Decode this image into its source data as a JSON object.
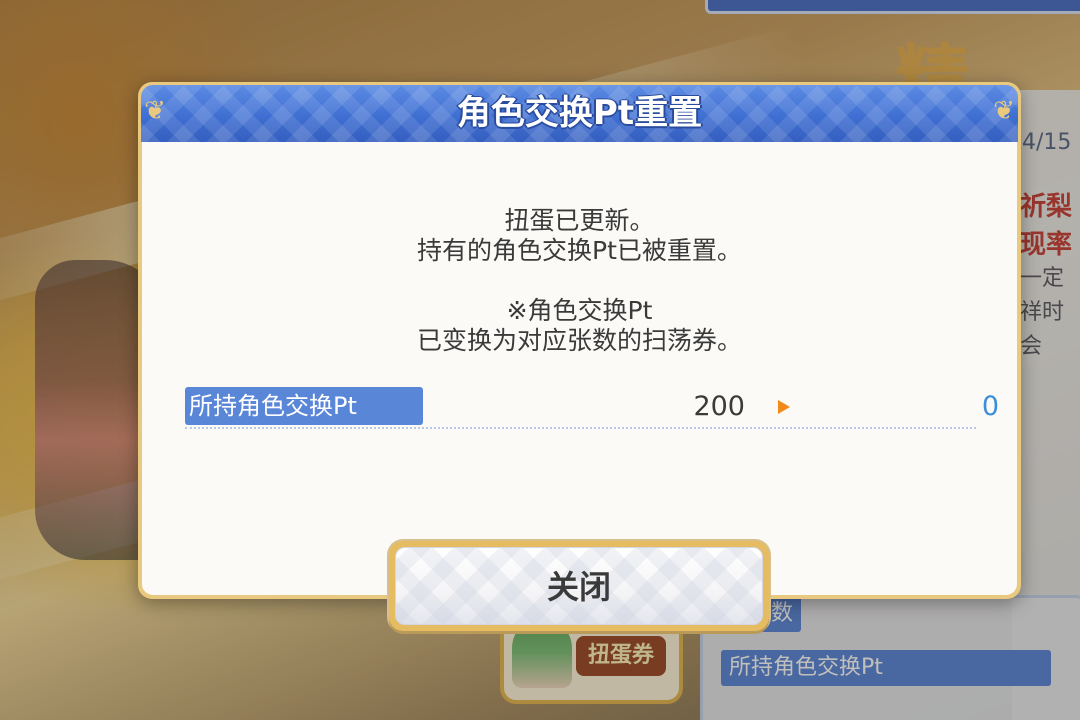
{
  "dialog": {
    "title": "角色交换Pt重置",
    "message_line1": "扭蛋已更新。",
    "message_line2": "持有的角色交换Pt已被重置。",
    "note_line1": "※角色交换Pt",
    "note_line2": "已变换为对应张数的扫荡券。",
    "pt_row": {
      "label": "所持角色交换Pt",
      "before": "200",
      "after": "0"
    },
    "close_label": "关闭"
  },
  "background": {
    "big_chars": "精选",
    "date_fragment": "4/15",
    "side_text_1": "祈梨",
    "side_text_2": "现率",
    "side_text_3": "一定",
    "side_text_4": "祥时会",
    "bottom_label_1": "持有数",
    "bottom_label_2": "所持角色交换Pt",
    "ticket_label": "扭蛋券"
  },
  "colors": {
    "header_blue": "#3f6fd2",
    "frame_gold": "#e9c97f",
    "label_blue": "#5a86d8",
    "arrow_orange": "#f08a1a",
    "after_value_blue": "#3a8fd8"
  }
}
